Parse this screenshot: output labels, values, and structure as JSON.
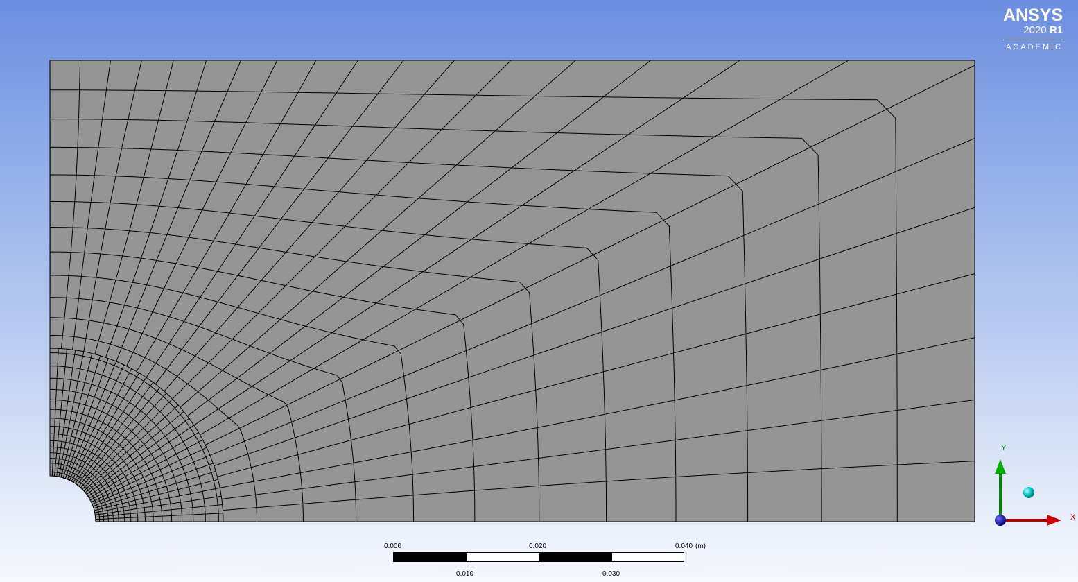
{
  "logo": {
    "brand": "ANSYS",
    "version_year": "2020",
    "version_release": "R1",
    "edition": "ACADEMIC"
  },
  "scale_bar": {
    "top_labels": [
      "0.000",
      "0.020",
      "0.040"
    ],
    "unit": "(m)",
    "bottom_labels": [
      "0.010",
      "0.030"
    ]
  },
  "triad": {
    "x_label": "X",
    "y_label": "Y",
    "x_color": "#c00000",
    "y_color": "#00a000",
    "origin_color": "#0000c0",
    "iso_ball_color": "#00c8c8"
  },
  "colors": {
    "mesh_fill": "#959595",
    "mesh_line": "#000000"
  },
  "icons": {
    "triad": "axis-triad-icon",
    "iso": "isometric-view-ball-icon"
  }
}
